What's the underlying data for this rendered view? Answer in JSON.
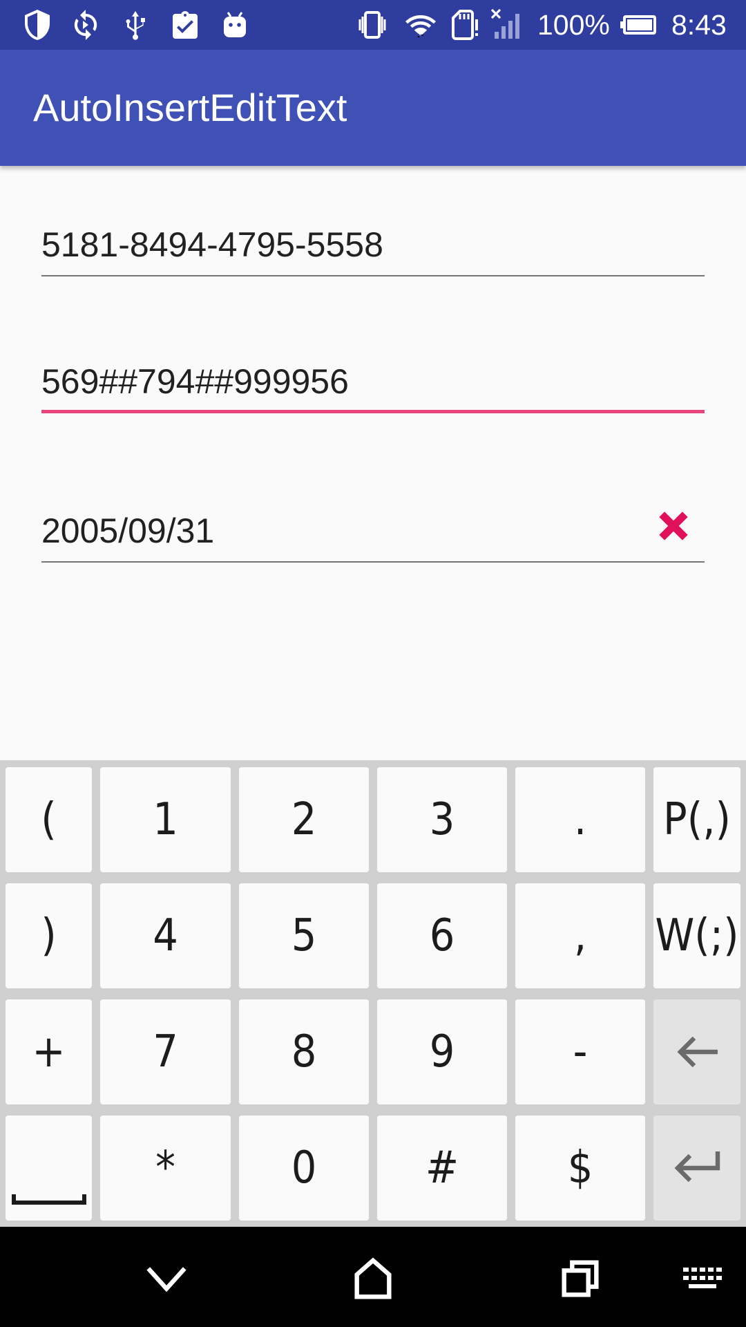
{
  "status_bar": {
    "battery_percent": "100%",
    "time": "8:43",
    "left_icons": [
      "shield-icon",
      "sync-icon",
      "usb-icon",
      "clipboard-check-icon",
      "android-icon"
    ],
    "right_icons": [
      "vibrate-icon",
      "wifi-icon",
      "sd-card-alert-icon",
      "signal-off-icon",
      "battery-icon"
    ]
  },
  "app_bar": {
    "title": "AutoInsertEditText"
  },
  "fields": [
    {
      "value": "5181-8494-4795-5558",
      "focused": false
    },
    {
      "value": "569##794##999956",
      "focused": true
    },
    {
      "value": "2005/09/31",
      "focused": false,
      "has_clear_icon": true
    }
  ],
  "colors": {
    "status_bar": "#2f3e9e",
    "app_bar": "#3f51b5",
    "focus_underline": "#e8457a",
    "clear_icon": "#e0105a"
  },
  "keyboard": {
    "rows": [
      [
        "(",
        "1",
        "2",
        "3",
        ".",
        "P(,)"
      ],
      [
        ")",
        "4",
        "5",
        "6",
        ",",
        "W(;)"
      ],
      [
        "+",
        "7",
        "8",
        "9",
        "-",
        "backspace-icon"
      ],
      [
        "space-icon",
        "*",
        "0",
        "#",
        "$",
        "enter-icon"
      ]
    ]
  },
  "nav_bar": {
    "icons": [
      "back-chevron-icon",
      "home-icon",
      "recents-icon",
      "keyboard-icon"
    ]
  }
}
